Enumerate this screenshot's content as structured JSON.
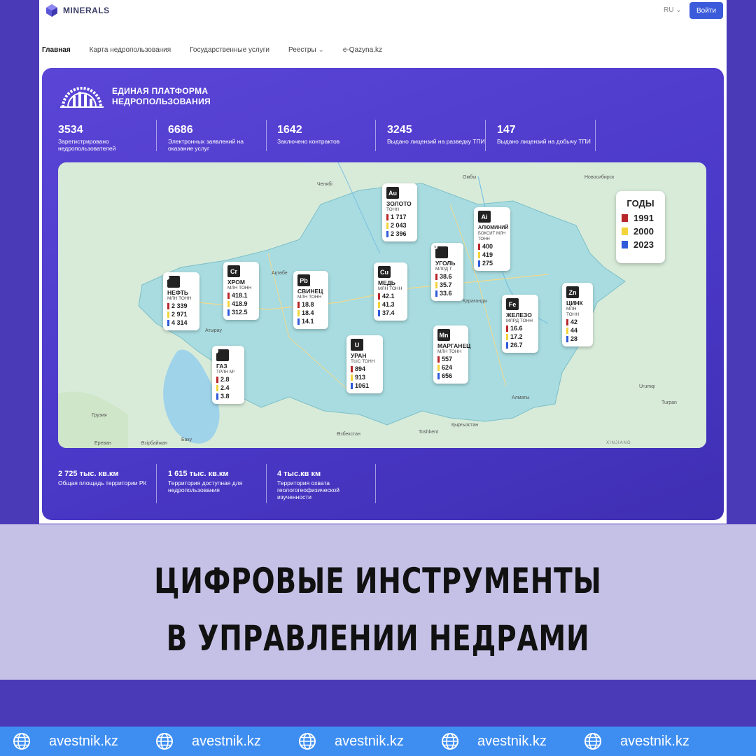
{
  "header": {
    "brand": "MINERALS",
    "lang": "RU",
    "login_label": "Войти"
  },
  "nav": {
    "items": [
      "Главная",
      "Карта недропользования",
      "Государственные услуги",
      "Реестры",
      "e-Qazyna.kz"
    ],
    "active_index": 0
  },
  "hero": {
    "title_line1": "ЕДИНАЯ ПЛАТФОРМА",
    "title_line2": "НЕДРОПОЛЬЗОВАНИЯ",
    "stats": [
      {
        "value": "3534",
        "label": "Зарегистрировано недропользователей"
      },
      {
        "value": "6686",
        "label": "Электронных заявлений на оказание услуг"
      },
      {
        "value": "1642",
        "label": "Заключено контрактов"
      },
      {
        "value": "3245",
        "label": "Выдано лицензий на разведку ТПИ"
      },
      {
        "value": "147",
        "label": "Выдано лицензий на добычу ТПИ"
      }
    ],
    "bottom_stats": [
      {
        "value": "2 725 тыс. кв.км",
        "label": "Общая площадь территории РК"
      },
      {
        "value": "1 615 тыс. кв.км",
        "label": "Территория доступная для недропользования"
      },
      {
        "value": "4 тыс.кв км",
        "label": "Территория охвата геологогеофизической изученности"
      }
    ]
  },
  "map": {
    "legend_title": "ГОДЫ",
    "years": [
      "1991",
      "2000",
      "2023"
    ],
    "year_colors": [
      "#b8262a",
      "#f2d43a",
      "#2e59d9"
    ],
    "places": [
      "Челябі",
      "Омбы",
      "Новосибирск",
      "Ақтөбе",
      "Атырау",
      "Қарағанды",
      "Алматы",
      "Өзбекстан",
      "Қырғызстан",
      "Грузия",
      "Әзірбайжан",
      "Баку",
      "Ереван",
      "Toshkent",
      "XINJIANG",
      "Urumqi",
      "Turpan"
    ],
    "resources": [
      {
        "sym": "Au",
        "name": "ЗОЛОТО",
        "unit": "ТОНН",
        "values": [
          "1 717",
          "2 043",
          "2 396"
        ]
      },
      {
        "sym": "Ai",
        "name": "АЛЮМИНИЙ",
        "unit": "БОКСИТ МЛН ТОНН",
        "values": [
          "400",
          "419",
          "275"
        ]
      },
      {
        "sym": "coal-icon",
        "name": "УГОЛЬ",
        "unit": "МЛРД Т",
        "values": [
          "38.6",
          "35.7",
          "33.6"
        ]
      },
      {
        "sym": "Cu",
        "name": "МЕДЬ",
        "unit": "МЛН ТОНН",
        "values": [
          "42.1",
          "41.3",
          "37.4"
        ]
      },
      {
        "sym": "Pb",
        "name": "СВИНЕЦ",
        "unit": "МЛН ТОНН",
        "values": [
          "18.8",
          "18.4",
          "14.1"
        ]
      },
      {
        "sym": "Cr",
        "name": "ХРОМ",
        "unit": "МЛН ТОНН",
        "values": [
          "418.1",
          "418.9",
          "312.5"
        ]
      },
      {
        "sym": "oil-drop-icon",
        "name": "НЕФТЬ",
        "unit": "МЛН ТОНН",
        "values": [
          "2 339",
          "2 971",
          "4 314"
        ]
      },
      {
        "sym": "flame-icon",
        "name": "ГАЗ",
        "unit": "ТРЛН М³",
        "values": [
          "2.8",
          "2.4",
          "3.8"
        ]
      },
      {
        "sym": "U",
        "name": "УРАН",
        "unit": "ТЫС ТОНН",
        "values": [
          "894",
          "913",
          "1061"
        ]
      },
      {
        "sym": "Mn",
        "name": "МАРГАНЕЦ",
        "unit": "МЛН ТОНН",
        "values": [
          "557",
          "624",
          "656"
        ]
      },
      {
        "sym": "Fe",
        "name": "ЖЕЛЕЗО",
        "unit": "МЛРД ТОНН",
        "values": [
          "16.6",
          "17.2",
          "26.7"
        ]
      },
      {
        "sym": "Zn",
        "name": "ЦИНК",
        "unit": "МЛН ТОНН",
        "values": [
          "42",
          "44",
          "28"
        ]
      }
    ]
  },
  "banner": {
    "line1": "ЦИФРОВЫЕ ИНСТРУМЕНТЫ",
    "line2": "В УПРАВЛЕНИИ НЕДРАМИ"
  },
  "footer": {
    "site": "avestnik.kz"
  }
}
